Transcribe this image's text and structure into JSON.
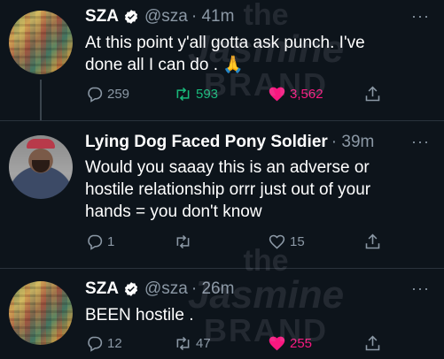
{
  "tweets": [
    {
      "name": "SZA",
      "handle": "@sza",
      "time": "· 41m",
      "text_line1": "At this point y'all gotta ask punch. I've",
      "text_line2": "done all I can do . 🙏",
      "replies": "259",
      "retweets": "593",
      "likes": "3,562",
      "verified": true
    },
    {
      "name": "Lying Dog Faced Pony Soldier",
      "handle": "",
      "time": "· 39m",
      "text_line1": "Would you saaay this is an adverse or",
      "text_line2": "hostile relationship orrr just out of your",
      "text_line3": "hands = you don't know",
      "replies": "1",
      "retweets": "",
      "likes": "15",
      "verified": false
    },
    {
      "name": "SZA",
      "handle": "@sza",
      "time": "· 26m",
      "text_line1": "BEEN hostile .",
      "replies": "12",
      "retweets": "47",
      "likes": "255",
      "verified": true
    }
  ],
  "more_glyph": "···",
  "watermark": {
    "line1": "the",
    "line2": "Jasmine",
    "line3": "BRAND"
  },
  "colors": {
    "background": "#0d141b",
    "secondary_text": "#8b98a5",
    "retweet_active": "#19ba7c",
    "like_active": "#f91880",
    "verified": "#ffffff"
  }
}
